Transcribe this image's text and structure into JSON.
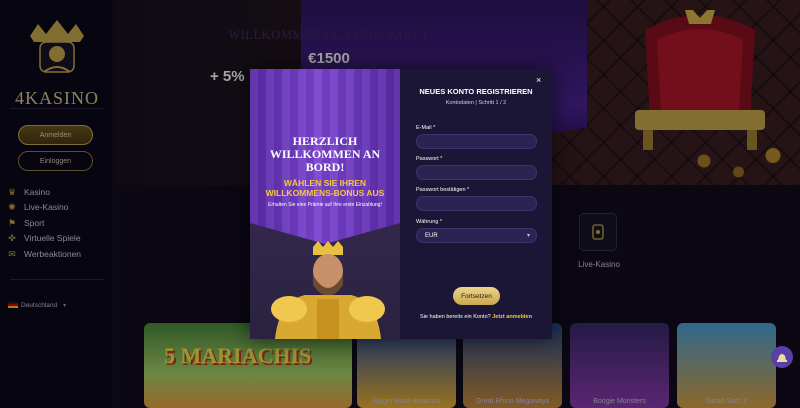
{
  "sidebar": {
    "logo_text": "4KASINO",
    "login_button": "Anmelden",
    "signin_button": "Einloggen",
    "nav": [
      {
        "label": "Kasino",
        "icon": "crown-icon"
      },
      {
        "label": "Live-Kasino",
        "icon": "live-icon"
      },
      {
        "label": "Sport",
        "icon": "sport-icon"
      },
      {
        "label": "Virtuelle Spiele",
        "icon": "gamepad-icon"
      },
      {
        "label": "Werbeaktionen",
        "icon": "promo-icon"
      }
    ],
    "language": "Deutschland"
  },
  "hero": {
    "title": "WILLKOMMENS-CASINO-PAKET",
    "amount": "€1500",
    "percent": "+ 5%"
  },
  "category": {
    "label": "Live-Kasino"
  },
  "games": [
    {
      "name": "Bigger Bass Bonanza"
    },
    {
      "name": "Great Rhino Megaways"
    },
    {
      "name": "Boogie Monsters"
    },
    {
      "name": "Safari Sam 2"
    }
  ],
  "game_banner_text": "5 MARIACHIS",
  "modal": {
    "welcome_text": "HERZLICH WILLKOMMEN AN BORD!",
    "choose_text": "WÄHLEN SIE IHREN WILLKOMMENS-BONUS AUS",
    "prize_text": "Erhalten Sie eine Prämie auf Ihre erste Einzahlung!",
    "title": "NEUES KONTO REGISTRIEREN",
    "subtitle": "Kontodaten | Schritt 1 / 2",
    "fields": {
      "email_label": "E-Mail *",
      "password_label": "Passwort *",
      "confirm_label": "Passwort bestätigen *",
      "currency_label": "Währung *",
      "currency_value": "EUR"
    },
    "continue_button": "Fortsetzen",
    "already_text": "Sie haben bereits ein Konto?",
    "login_link": "Jetzt anmelden",
    "close": "×"
  },
  "colors": {
    "accent_gold": "#c9a94e",
    "modal_bg": "#1b1635",
    "banner_purple": "#6a36bc"
  }
}
